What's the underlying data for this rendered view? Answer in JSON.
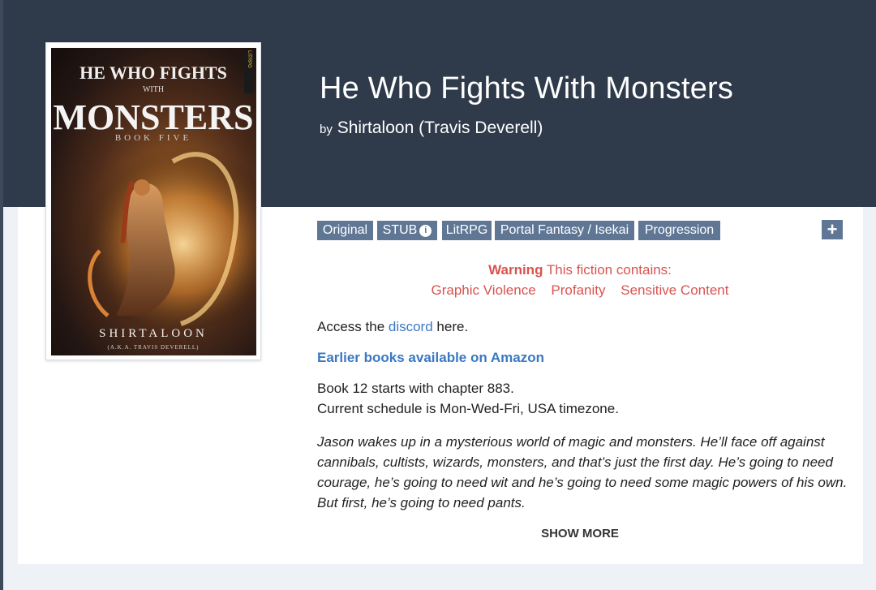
{
  "fiction": {
    "title": "He Who Fights With Monsters",
    "by_label": "by",
    "author": "Shirtaloon (Travis Deverell)"
  },
  "cover": {
    "line1": "HE WHO FIGHTS",
    "line2": "WITH",
    "line3": "MONSTERS",
    "line4": "BOOK FIVE",
    "author_name": "SHIRTALOON",
    "author_aka": "(A.K.A. TRAVIS DEVERELL)",
    "publisher_badge": "LITRPG"
  },
  "tags": [
    "Original",
    "STUB",
    "LitRPG",
    "Portal Fantasy / Isekai",
    "Progression"
  ],
  "stub_info_icon": "info-icon",
  "more_tags_label": "+",
  "warning": {
    "label": "Warning",
    "text": "This fiction contains:",
    "items": [
      "Graphic Violence",
      "Profanity",
      "Sensitive Content"
    ]
  },
  "description": {
    "discord_prefix": "Access the ",
    "discord_link": "discord",
    "discord_suffix": " here.",
    "amazon_link": "Earlier books available on Amazon",
    "book12": "Book 12 starts with chapter 883.",
    "schedule": "Current schedule is Mon-Wed-Fri, USA timezone.",
    "synopsis": "Jason wakes up in a mysterious world of magic and monsters. He’ll face off against cannibals, cultists, wizards, monsters, and that’s just the first day. He’s going to need courage, he’s going to need wit and he’s going to need some magic powers of his own. But first, he’s going to need pants."
  },
  "show_more_label": "SHOW MORE"
}
